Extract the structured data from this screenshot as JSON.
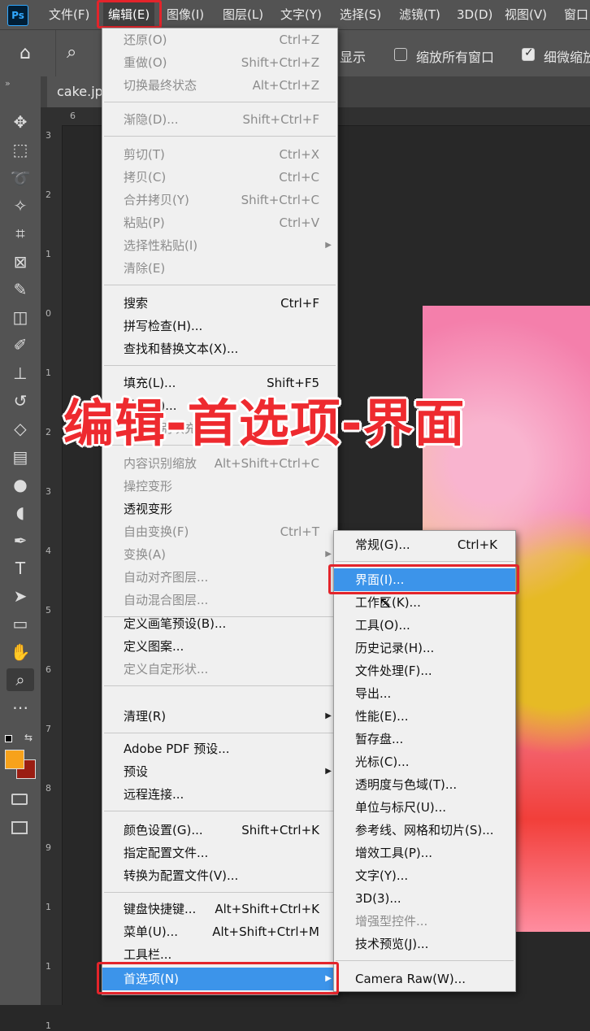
{
  "app_logo": "Ps",
  "menubar": [
    {
      "label": "文件(F)",
      "active": false
    },
    {
      "label": "编辑(E)",
      "active": true
    },
    {
      "label": "图像(I)",
      "active": false
    },
    {
      "label": "图层(L)",
      "active": false
    },
    {
      "label": "文字(Y)",
      "active": false
    },
    {
      "label": "选择(S)",
      "active": false
    },
    {
      "label": "滤镜(T)",
      "active": false
    },
    {
      "label": "3D(D)",
      "active": false
    },
    {
      "label": "视图(V)",
      "active": false
    },
    {
      "label": "窗口",
      "active": false
    }
  ],
  "options": {
    "show_label_partial": "显示",
    "zoom_all_windows": "缩放所有窗口",
    "scrubby_zoom": "细微缩放"
  },
  "document": {
    "tab_name": "cake.jp",
    "ruler_h_first": "6",
    "ruler_v": [
      "3",
      "2",
      "1",
      "0",
      "1",
      "2",
      "3",
      "4",
      "5",
      "6",
      "7",
      "8",
      "9",
      "1",
      "1",
      "1"
    ]
  },
  "edit_menu": {
    "groups": [
      [
        {
          "label": "还原(O)",
          "shortcut": "Ctrl+Z",
          "enabled": false
        },
        {
          "label": "重做(O)",
          "shortcut": "Shift+Ctrl+Z",
          "enabled": false
        },
        {
          "label": "切换最终状态",
          "shortcut": "Alt+Ctrl+Z",
          "enabled": false
        }
      ],
      [
        {
          "label": "渐隐(D)...",
          "shortcut": "Shift+Ctrl+F",
          "enabled": false
        }
      ],
      [
        {
          "label": "剪切(T)",
          "shortcut": "Ctrl+X",
          "enabled": false
        },
        {
          "label": "拷贝(C)",
          "shortcut": "Ctrl+C",
          "enabled": false
        },
        {
          "label": "合并拷贝(Y)",
          "shortcut": "Shift+Ctrl+C",
          "enabled": false
        },
        {
          "label": "粘贴(P)",
          "shortcut": "Ctrl+V",
          "enabled": false
        },
        {
          "label": "选择性粘贴(I)",
          "shortcut": "",
          "enabled": false,
          "submenu": true
        },
        {
          "label": "清除(E)",
          "shortcut": "",
          "enabled": false
        }
      ],
      [
        {
          "label": "搜索",
          "shortcut": "Ctrl+F",
          "enabled": true
        },
        {
          "label": "拼写检查(H)...",
          "shortcut": "",
          "enabled": true
        },
        {
          "label": "查找和替换文本(X)...",
          "shortcut": "",
          "enabled": true
        }
      ],
      [
        {
          "label": "填充(L)...",
          "shortcut": "Shift+F5",
          "enabled": true
        },
        {
          "label": "描边(S)...",
          "shortcut": "",
          "enabled": true
        },
        {
          "label": "内容识别填充",
          "shortcut": "",
          "enabled": false
        }
      ],
      [
        {
          "label": "内容识别缩放",
          "shortcut": "Alt+Shift+Ctrl+C",
          "enabled": false
        },
        {
          "label": "操控变形",
          "shortcut": "",
          "enabled": false
        },
        {
          "label": "透视变形",
          "shortcut": "",
          "enabled": true
        },
        {
          "label": "自由变换(F)",
          "shortcut": "Ctrl+T",
          "enabled": false
        },
        {
          "label": "变换(A)",
          "shortcut": "",
          "enabled": false,
          "submenu": true
        },
        {
          "label": "自动对齐图层...",
          "shortcut": "",
          "enabled": false
        },
        {
          "label": "自动混合图层...",
          "shortcut": "",
          "enabled": false
        }
      ],
      [
        {
          "label": "定义画笔预设(B)...",
          "shortcut": "",
          "enabled": true
        },
        {
          "label": "定义图案...",
          "shortcut": "",
          "enabled": true
        },
        {
          "label": "定义自定形状...",
          "shortcut": "",
          "enabled": false
        }
      ],
      [
        {
          "label": "清理(R)",
          "shortcut": "",
          "enabled": true,
          "submenu": true
        }
      ],
      [
        {
          "label": "Adobe PDF 预设...",
          "shortcut": "",
          "enabled": true
        },
        {
          "label": "预设",
          "shortcut": "",
          "enabled": true,
          "submenu": true
        },
        {
          "label": "远程连接...",
          "shortcut": "",
          "enabled": true
        }
      ],
      [
        {
          "label": "颜色设置(G)...",
          "shortcut": "Shift+Ctrl+K",
          "enabled": true
        },
        {
          "label": "指定配置文件...",
          "shortcut": "",
          "enabled": true
        },
        {
          "label": "转换为配置文件(V)...",
          "shortcut": "",
          "enabled": true
        }
      ],
      [
        {
          "label": "键盘快捷键...",
          "shortcut": "Alt+Shift+Ctrl+K",
          "enabled": true
        },
        {
          "label": "菜单(U)...",
          "shortcut": "Alt+Shift+Ctrl+M",
          "enabled": true
        },
        {
          "label": "工具栏...",
          "shortcut": "",
          "enabled": true
        }
      ],
      [
        {
          "label": "首选项(N)",
          "shortcut": "",
          "enabled": true,
          "submenu": true,
          "highlighted": true
        }
      ]
    ]
  },
  "prefs_submenu": {
    "groups": [
      [
        {
          "label": "常规(G)...",
          "shortcut": "Ctrl+K",
          "enabled": true
        }
      ],
      [
        {
          "label": "界面(I)...",
          "shortcut": "",
          "enabled": true,
          "highlighted": true
        },
        {
          "label": "工作区(K)...",
          "shortcut": "",
          "enabled": true
        },
        {
          "label": "工具(O)...",
          "shortcut": "",
          "enabled": true
        },
        {
          "label": "历史记录(H)...",
          "shortcut": "",
          "enabled": true
        },
        {
          "label": "文件处理(F)...",
          "shortcut": "",
          "enabled": true
        },
        {
          "label": "导出...",
          "shortcut": "",
          "enabled": true
        },
        {
          "label": "性能(E)...",
          "shortcut": "",
          "enabled": true
        },
        {
          "label": "暂存盘...",
          "shortcut": "",
          "enabled": true
        },
        {
          "label": "光标(C)...",
          "shortcut": "",
          "enabled": true
        },
        {
          "label": "透明度与色域(T)...",
          "shortcut": "",
          "enabled": true
        },
        {
          "label": "单位与标尺(U)...",
          "shortcut": "",
          "enabled": true
        },
        {
          "label": "参考线、网格和切片(S)...",
          "shortcut": "",
          "enabled": true
        },
        {
          "label": "增效工具(P)...",
          "shortcut": "",
          "enabled": true
        },
        {
          "label": "文字(Y)...",
          "shortcut": "",
          "enabled": true
        },
        {
          "label": "3D(3)...",
          "shortcut": "",
          "enabled": true
        },
        {
          "label": "增强型控件...",
          "shortcut": "",
          "enabled": false
        },
        {
          "label": "技术预览(J)...",
          "shortcut": "",
          "enabled": true
        }
      ],
      [
        {
          "label": "Camera Raw(W)...",
          "shortcut": "",
          "enabled": true
        }
      ]
    ]
  },
  "overlay_caption": "编辑-首选项-界面",
  "tools": [
    "move-tool-icon",
    "marquee-tool-icon",
    "lasso-tool-icon",
    "magic-wand-icon",
    "crop-tool-icon",
    "frame-tool-icon",
    "eyedropper-icon",
    "healing-brush-icon",
    "brush-tool-icon",
    "stamp-tool-icon",
    "history-brush-icon",
    "eraser-icon",
    "gradient-icon",
    "blur-icon",
    "dodge-icon",
    "pen-tool-icon",
    "type-tool-icon",
    "path-select-icon",
    "rectangle-tool-icon",
    "hand-tool-icon",
    "zoom-tool-icon",
    "more-tools-icon"
  ],
  "colors": {
    "foreground": "#f7a21b",
    "background": "#9b1d12",
    "highlight": "#3c94ea",
    "callout": "#e3242b"
  }
}
